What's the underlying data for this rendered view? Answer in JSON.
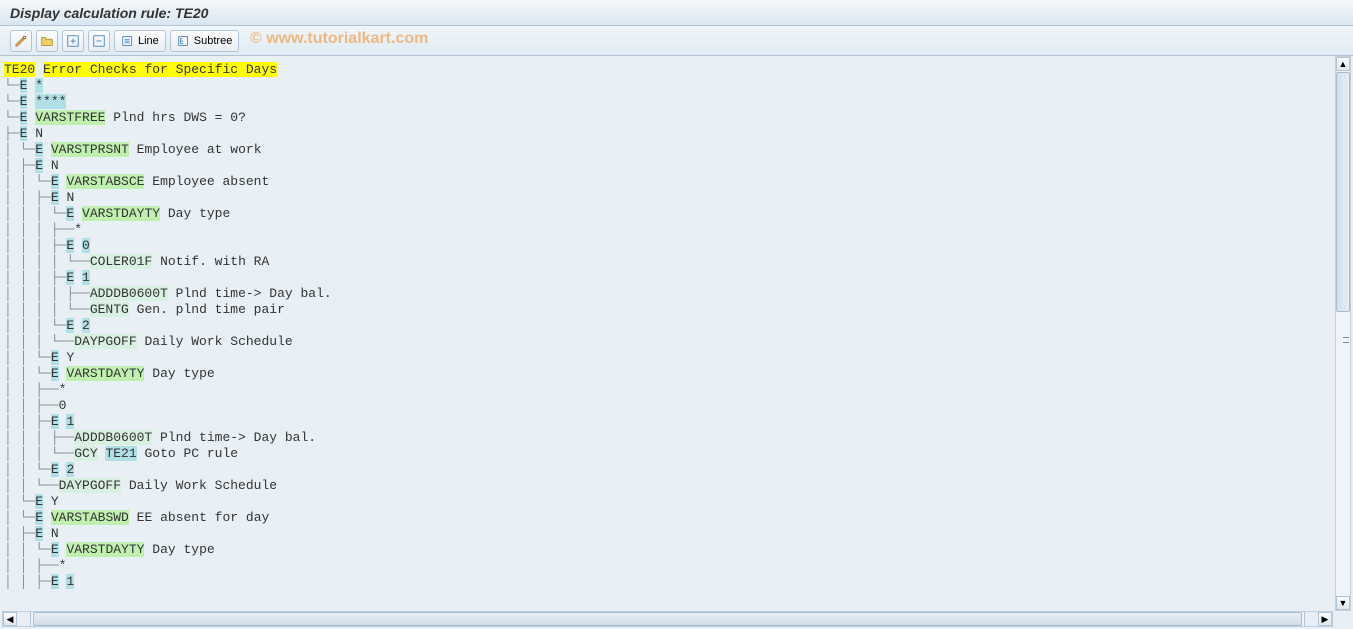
{
  "header": {
    "title": "Display calculation rule: TE20"
  },
  "toolbar": {
    "line_label": "Line",
    "subtree_label": "Subtree"
  },
  "watermark": "© www.tutorialkart.com",
  "tree": {
    "root_code": "TE20",
    "root_desc": "Error Checks for Specific Days",
    "n1": {
      "e": "E",
      "star": "*"
    },
    "n2": {
      "e": "E",
      "stars": "****"
    },
    "n3": {
      "e": "E",
      "var": "VARSTFREE",
      "desc": "Plnd hrs DWS = 0?"
    },
    "n4": {
      "e": "E",
      "v": "N"
    },
    "n5": {
      "e": "E",
      "var": "VARSTPRSNT",
      "desc": "Employee at work"
    },
    "n6": {
      "e": "E",
      "v": "N"
    },
    "n7": {
      "e": "E",
      "var": "VARSTABSCE",
      "desc": "Employee absent"
    },
    "n8": {
      "e": "E",
      "v": "N"
    },
    "n9": {
      "e": "E",
      "var": "VARSTDAYTY",
      "desc": "Day type"
    },
    "n10": {
      "star": "*"
    },
    "n11": {
      "e": "E",
      "v": "0"
    },
    "n12": {
      "op": "COLER01F",
      "desc": "Notif. with RA"
    },
    "n13": {
      "e": "E",
      "v": "1"
    },
    "n14": {
      "op": "ADDDB0600T",
      "desc": "Plnd time-> Day bal."
    },
    "n15": {
      "op": "GENTG",
      "desc": "Gen. plnd time pair"
    },
    "n16": {
      "e": "E",
      "v": "2"
    },
    "n17": {
      "op": "DAYPGOFF",
      "desc": "Daily Work Schedule"
    },
    "n18": {
      "e": "E",
      "v": "Y"
    },
    "n19": {
      "e": "E",
      "var": "VARSTDAYTY",
      "desc": "Day type"
    },
    "n20": {
      "star": "*"
    },
    "n21": {
      "v": "0"
    },
    "n22": {
      "e": "E",
      "v": "1"
    },
    "n23": {
      "op": "ADDDB0600T",
      "desc": "Plnd time-> Day bal."
    },
    "n24": {
      "op1": "GCY",
      "op2": "TE21",
      "desc": "Goto PC rule"
    },
    "n25": {
      "e": "E",
      "v": "2"
    },
    "n26": {
      "op": "DAYPGOFF",
      "desc": "Daily Work Schedule"
    },
    "n27": {
      "e": "E",
      "v": "Y"
    },
    "n28": {
      "e": "E",
      "var": "VARSTABSWD",
      "desc": "EE absent for day"
    },
    "n29": {
      "e": "E",
      "v": "N"
    },
    "n30": {
      "e": "E",
      "var": "VARSTDAYTY",
      "desc": "Day type"
    },
    "n31": {
      "star": "*"
    },
    "n32": {
      "e": "E",
      "v": "1"
    }
  }
}
